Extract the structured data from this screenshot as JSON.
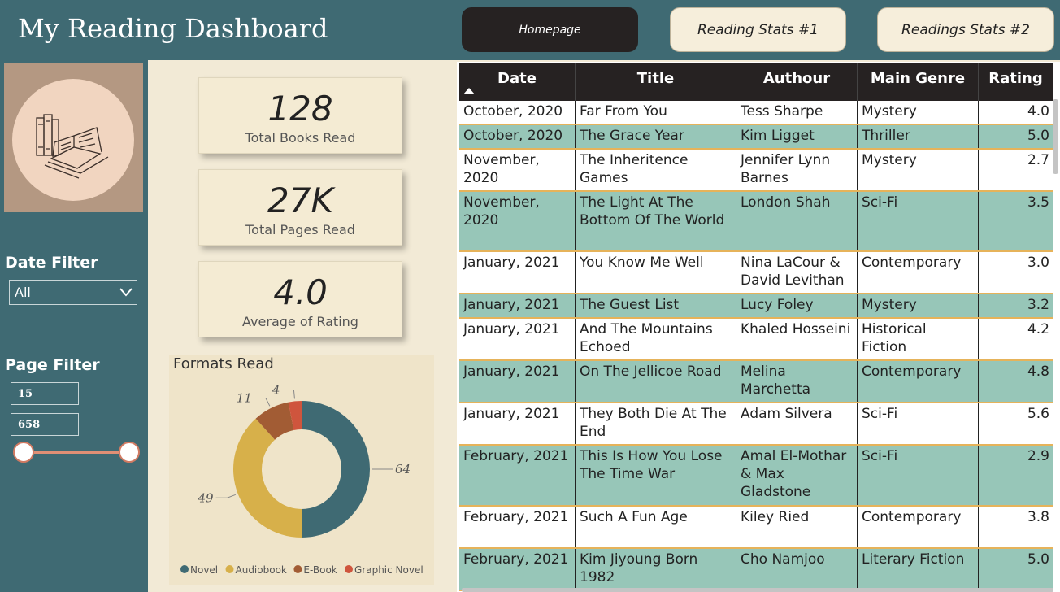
{
  "header": {
    "title": "My Reading Dashboard"
  },
  "nav": {
    "homepage": "Homepage",
    "stats1": "Reading Stats #1",
    "stats2": "Readings Stats #2"
  },
  "sidebar": {
    "date_filter_title": "Date Filter",
    "date_filter_value": "All",
    "page_filter_title": "Page Filter",
    "page_min": "15",
    "page_max": "658"
  },
  "kpis": {
    "books": {
      "value": "128",
      "label": "Total Books Read"
    },
    "pages": {
      "value": "27K",
      "label": "Total Pages Read"
    },
    "rating": {
      "value": "4.0",
      "label": "Average of Rating"
    }
  },
  "colors": {
    "novel": "#3f6a73",
    "audiobook": "#d7b04a",
    "ebook": "#a25c34",
    "graphic_novel": "#cf553d"
  },
  "chart_data": {
    "type": "pie",
    "title": "Formats Read",
    "categories": [
      "Novel",
      "Audiobook",
      "E-Book",
      "Graphic Novel"
    ],
    "values": [
      64,
      49,
      11,
      4
    ],
    "legend": "bottom"
  },
  "table": {
    "columns": [
      "Date",
      "Title",
      "Authour",
      "Main Genre",
      "Rating"
    ],
    "rows": [
      [
        "October, 2020",
        "Far From You",
        "Tess Sharpe",
        "Mystery",
        "4.0"
      ],
      [
        "October, 2020",
        "The Grace Year",
        "Kim Ligget",
        "Thriller",
        "5.0"
      ],
      [
        "November, 2020",
        "The Inheritence Games",
        "Jennifer Lynn Barnes",
        "Mystery",
        "2.7"
      ],
      [
        "November, 2020",
        "The Light At The Bottom Of The World",
        "London Shah",
        "Sci-Fi",
        "3.5"
      ],
      [
        "January, 2021",
        "You Know Me Well",
        "Nina LaCour & David Levithan",
        "Contemporary",
        "3.0"
      ],
      [
        "January, 2021",
        "The Guest List",
        "Lucy Foley",
        "Mystery",
        "3.2"
      ],
      [
        "January, 2021",
        "And The Mountains Echoed",
        "Khaled Hosseini",
        "Historical Fiction",
        "4.2"
      ],
      [
        "January, 2021",
        "On The Jellicoe Road",
        "Melina Marchetta",
        "Contemporary",
        "4.8"
      ],
      [
        "January, 2021",
        "They Both Die At The End",
        "Adam Silvera",
        "Sci-Fi",
        "5.6"
      ],
      [
        "February, 2021",
        "This Is How You Lose The Time War",
        "Amal El-Mothar & Max Gladstone",
        "Sci-Fi",
        "2.9"
      ],
      [
        "February, 2021",
        "Such A Fun Age",
        "Kiley Ried",
        "Contemporary",
        "3.8"
      ],
      [
        "February, 2021",
        "Kim Jiyoung Born 1982",
        "Cho Namjoo",
        "Literary Fiction",
        "5.0"
      ]
    ]
  }
}
